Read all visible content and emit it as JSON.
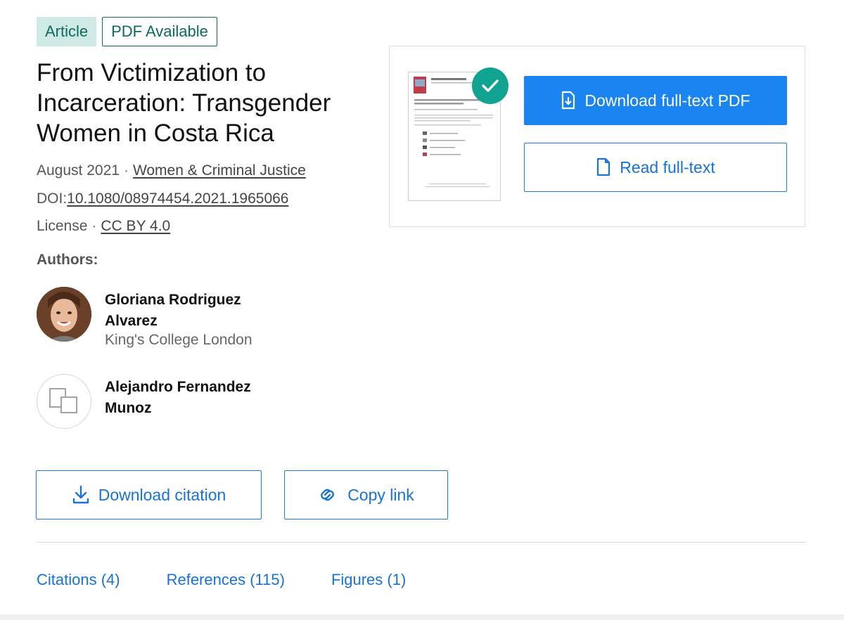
{
  "badges": {
    "article": "Article",
    "pdf": "PDF Available"
  },
  "title": "From Victimization to Incarceration: Transgender Women in Costa Rica",
  "meta": {
    "date": "August 2021",
    "journal": "Women & Criminal Justice",
    "doi_prefix": "DOI:",
    "doi": "10.1080/08974454.2021.1965066",
    "license_label": "License",
    "license": "CC BY 4.0"
  },
  "authors_label": "Authors:",
  "authors": [
    {
      "name": "Gloriana Rodriguez Alvarez",
      "affiliation": "King's College London"
    },
    {
      "name": "Alejandro Fernandez Munoz",
      "affiliation": ""
    }
  ],
  "actions": {
    "download_citation": "Download citation",
    "copy_link": "Copy link"
  },
  "panel": {
    "download_pdf": "Download full-text PDF",
    "read_fulltext": "Read full-text"
  },
  "tabs": [
    "Citations (4)",
    "References (115)",
    "Figures (1)"
  ],
  "colors": {
    "accent": "#1a85f0",
    "link": "#1773d6",
    "badge_teal": "#0d6a5e",
    "check_green": "#11a391"
  },
  "icons": {
    "download_citation": "download-arrow-icon",
    "copy_link": "link-icon",
    "download_pdf": "file-download-icon",
    "read_fulltext": "document-icon",
    "check": "check-icon",
    "avatar_placeholder": "copy-squares-icon"
  }
}
